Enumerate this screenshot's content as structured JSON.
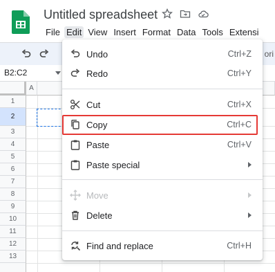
{
  "document": {
    "title": "Untitled spreadsheet"
  },
  "menubar": {
    "items": [
      "File",
      "Edit",
      "View",
      "Insert",
      "Format",
      "Data",
      "Tools",
      "Extensi"
    ]
  },
  "toolbar": {
    "right_text": "ori"
  },
  "namebox": {
    "value": "B2:C2"
  },
  "grid": {
    "column_headers": [
      "A"
    ],
    "row_headers": [
      "1",
      "2",
      "3",
      "4",
      "5",
      "6",
      "7",
      "8",
      "9",
      "10",
      "11",
      "12",
      "13"
    ],
    "selected_row": "2"
  },
  "edit_menu": {
    "items": [
      {
        "label": "Undo",
        "shortcut": "Ctrl+Z",
        "icon": "undo-icon"
      },
      {
        "label": "Redo",
        "shortcut": "Ctrl+Y",
        "icon": "redo-icon"
      },
      {
        "label": "Cut",
        "shortcut": "Ctrl+X",
        "icon": "scissors-icon"
      },
      {
        "label": "Copy",
        "shortcut": "Ctrl+C",
        "icon": "copy-icon"
      },
      {
        "label": "Paste",
        "shortcut": "Ctrl+V",
        "icon": "clipboard-icon"
      },
      {
        "label": "Paste special",
        "submenu": true,
        "icon": "clipboard-icon"
      },
      {
        "label": "Move",
        "submenu": true,
        "disabled": true,
        "icon": "move-icon"
      },
      {
        "label": "Delete",
        "submenu": true,
        "icon": "trash-icon"
      },
      {
        "label": "Find and replace",
        "shortcut": "Ctrl+H",
        "icon": "find-replace-icon"
      }
    ]
  },
  "colors": {
    "sheets_green": "#0f9d58",
    "highlight_red": "#e53935",
    "selection_blue": "#1a73e8"
  }
}
